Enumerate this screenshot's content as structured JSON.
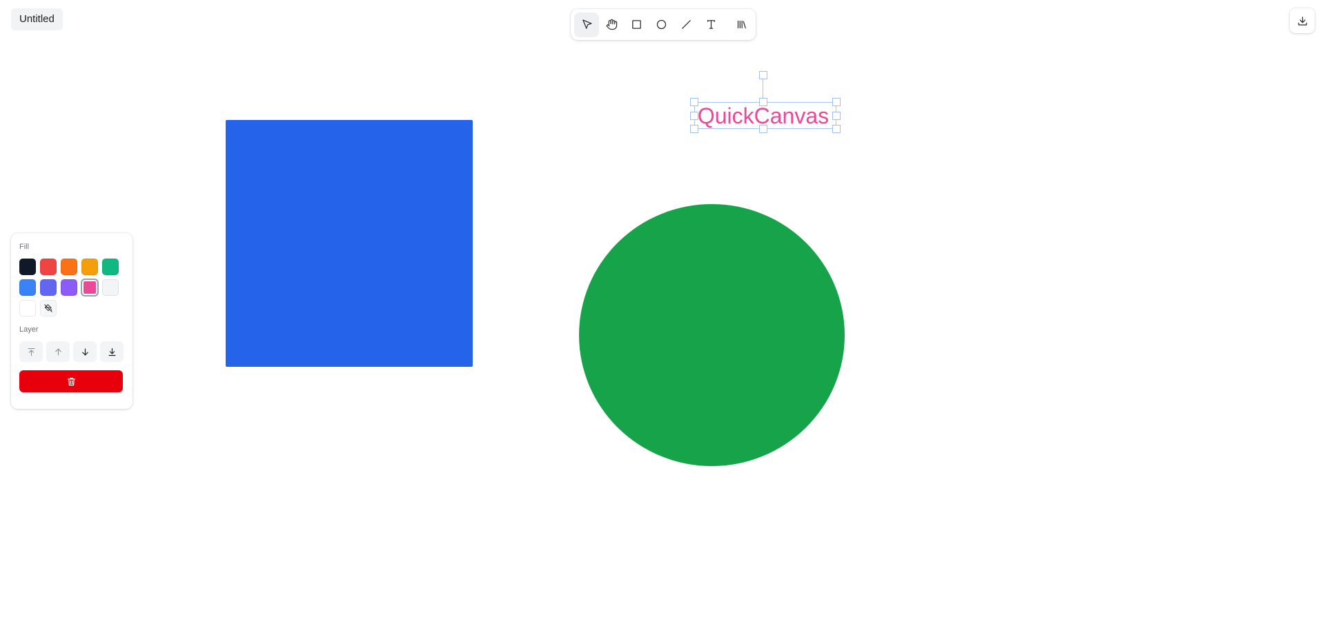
{
  "document": {
    "title": "Untitled"
  },
  "toolbar": {
    "tools": [
      {
        "id": "select",
        "icon": "cursor-icon",
        "active": true
      },
      {
        "id": "hand",
        "icon": "hand-icon",
        "active": false
      },
      {
        "id": "rectangle",
        "icon": "square-icon",
        "active": false
      },
      {
        "id": "ellipse",
        "icon": "circle-icon",
        "active": false
      },
      {
        "id": "line",
        "icon": "line-icon",
        "active": false
      },
      {
        "id": "text",
        "icon": "text-icon",
        "active": false
      },
      {
        "id": "library",
        "icon": "library-icon",
        "active": false
      }
    ]
  },
  "export": {
    "icon": "download-icon"
  },
  "properties_panel": {
    "fill_label": "Fill",
    "fill_swatches": [
      "#111827",
      "#ef4444",
      "#f97316",
      "#f59e0b",
      "#10b981",
      "#3b82f6",
      "#6366f1",
      "#8b5cf6",
      "#ec4899",
      "#f3f4f6",
      "#ffffff"
    ],
    "selected_swatch": "#ec4899",
    "no_fill_icon": "paint-bucket-off-icon",
    "layer_label": "Layer",
    "layer_actions": [
      {
        "id": "bring-to-front",
        "icon": "arrow-up-to-line-icon",
        "enabled": false
      },
      {
        "id": "bring-forward",
        "icon": "arrow-up-icon",
        "enabled": false
      },
      {
        "id": "send-backward",
        "icon": "arrow-down-icon",
        "enabled": true
      },
      {
        "id": "send-to-back",
        "icon": "arrow-down-to-line-icon",
        "enabled": true
      }
    ],
    "delete_icon": "trash-icon",
    "delete_color": "#e7000b"
  },
  "canvas": {
    "shapes": [
      {
        "type": "rectangle",
        "fill": "#2563eb"
      },
      {
        "type": "ellipse",
        "fill": "#16a34a"
      },
      {
        "type": "text",
        "text": "QuickCanvas",
        "color": "#ec4899",
        "selected": true
      }
    ]
  }
}
